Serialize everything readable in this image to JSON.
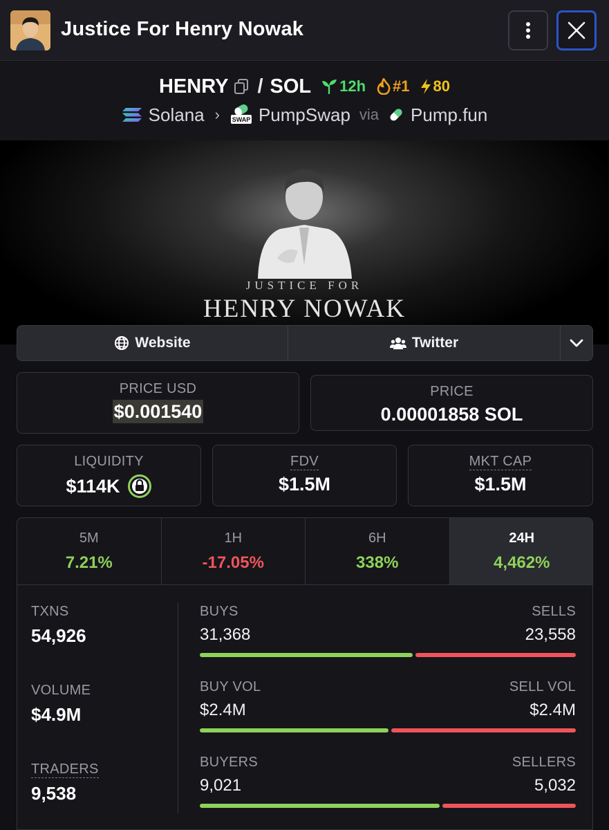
{
  "header": {
    "title": "Justice For Henry Nowak",
    "avatar_icon": "token-avatar",
    "menu_icon": "kebab-menu-icon",
    "close_icon": "close-icon"
  },
  "pair": {
    "base": "HENRY",
    "quote": "SOL",
    "separator": "/",
    "age": "12h",
    "rank": "#1",
    "boosts": "80"
  },
  "chain": {
    "network": "Solana",
    "dex": "PumpSwap",
    "dex_badge": "SWAP",
    "via_label": "via",
    "launchpad": "Pump.fun"
  },
  "banner": {
    "subtitle": "JUSTICE FOR",
    "title": "HENRY NOWAK"
  },
  "links": {
    "website": "Website",
    "twitter": "Twitter"
  },
  "stats": {
    "price_usd_label": "PRICE USD",
    "price_usd": "$0.001540",
    "price_label": "PRICE",
    "price_native": "0.00001858 SOL",
    "liquidity_label": "LIQUIDITY",
    "liquidity": "$114K",
    "fdv_label": "FDV",
    "fdv": "$1.5M",
    "mcap_label": "MKT CAP",
    "mcap": "$1.5M"
  },
  "timeframes": [
    {
      "label": "5M",
      "change": "7.21%",
      "direction": "up"
    },
    {
      "label": "1H",
      "change": "-17.05%",
      "direction": "down"
    },
    {
      "label": "6H",
      "change": "338%",
      "direction": "up"
    },
    {
      "label": "24H",
      "change": "4,462%",
      "direction": "up",
      "active": true
    }
  ],
  "txns": {
    "txns_label": "TXNS",
    "txns": "54,926",
    "volume_label": "VOLUME",
    "volume": "$4.9M",
    "traders_label": "TRADERS",
    "traders": "9,538",
    "buys_label": "BUYS",
    "buys": "31,368",
    "sells_label": "SELLS",
    "sells": "23,558",
    "buy_vol_label": "BUY VOL",
    "buy_vol": "$2.4M",
    "sell_vol_label": "SELL VOL",
    "sell_vol": "$2.4M",
    "buyers_label": "BUYERS",
    "buyers": "9,021",
    "sellers_label": "SELLERS",
    "sellers": "5,032",
    "buy_share": {
      "txns": 0.571,
      "volume": 0.505,
      "makers": 0.642
    }
  },
  "colors": {
    "positive": "#8fd15a",
    "negative": "#f0545a",
    "accent_border": "#2c54c8",
    "age": "#4fdc6c",
    "rank": "#f0a01c"
  }
}
